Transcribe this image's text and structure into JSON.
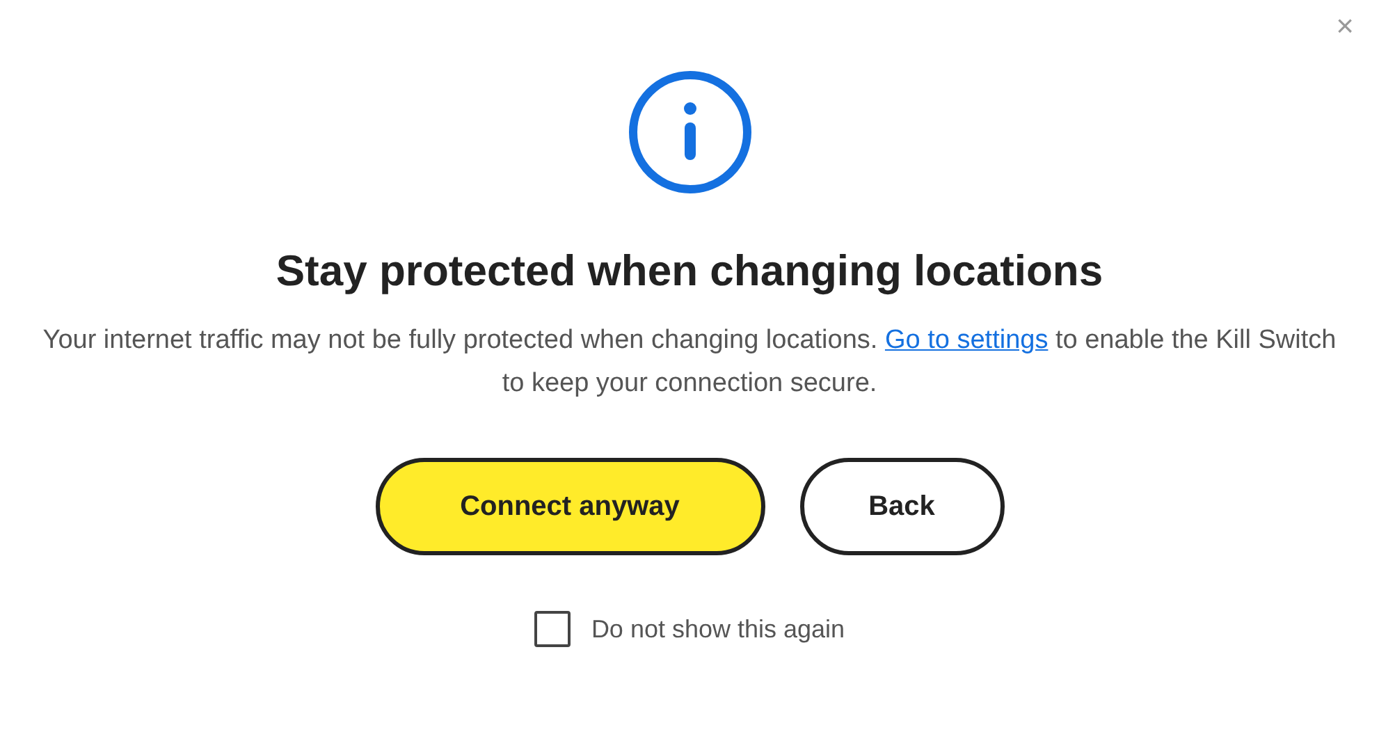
{
  "dialog": {
    "close": "×",
    "title": "Stay protected when changing locations",
    "message": {
      "before": "Your internet traffic may not be fully protected when changing locations.",
      "link": "Go to settings",
      "after": "to enable the Kill Switch to keep your connection secure."
    },
    "buttons": [
      {
        "label": "Connect anyway",
        "kind": "primary"
      },
      {
        "label": "Back",
        "kind": "secondary"
      }
    ],
    "checkbox": {
      "label": "Do not show this again",
      "checked": false
    }
  }
}
